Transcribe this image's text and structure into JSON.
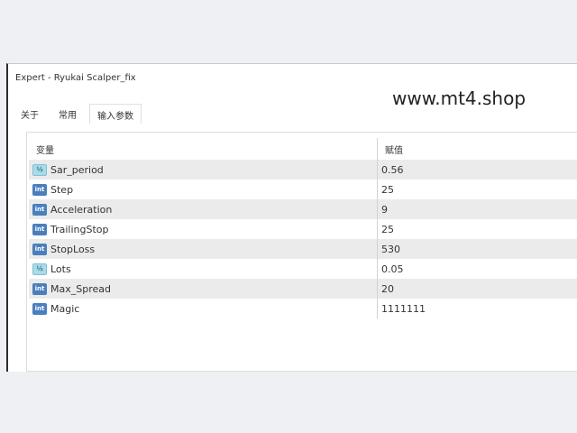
{
  "window": {
    "title": "Expert - Ryukai Scalper_fix"
  },
  "watermark": "www.mt4.shop",
  "tabs": [
    "关于",
    "常用",
    "输入参数"
  ],
  "table": {
    "headers": {
      "variable": "变量",
      "value": "赋值"
    },
    "rows": [
      {
        "type": "double",
        "type_label": "½",
        "name": "Sar_period",
        "value": "0.56"
      },
      {
        "type": "int",
        "type_label": "int",
        "name": "Step",
        "value": "25"
      },
      {
        "type": "int",
        "type_label": "int",
        "name": "Acceleration",
        "value": "9"
      },
      {
        "type": "int",
        "type_label": "int",
        "name": "TrailingStop",
        "value": "25"
      },
      {
        "type": "int",
        "type_label": "int",
        "name": "StopLoss",
        "value": "530"
      },
      {
        "type": "double",
        "type_label": "½",
        "name": "Lots",
        "value": "0.05"
      },
      {
        "type": "int",
        "type_label": "int",
        "name": "Max_Spread",
        "value": "20"
      },
      {
        "type": "int",
        "type_label": "int",
        "name": "Magic",
        "value": "1111111"
      }
    ]
  }
}
